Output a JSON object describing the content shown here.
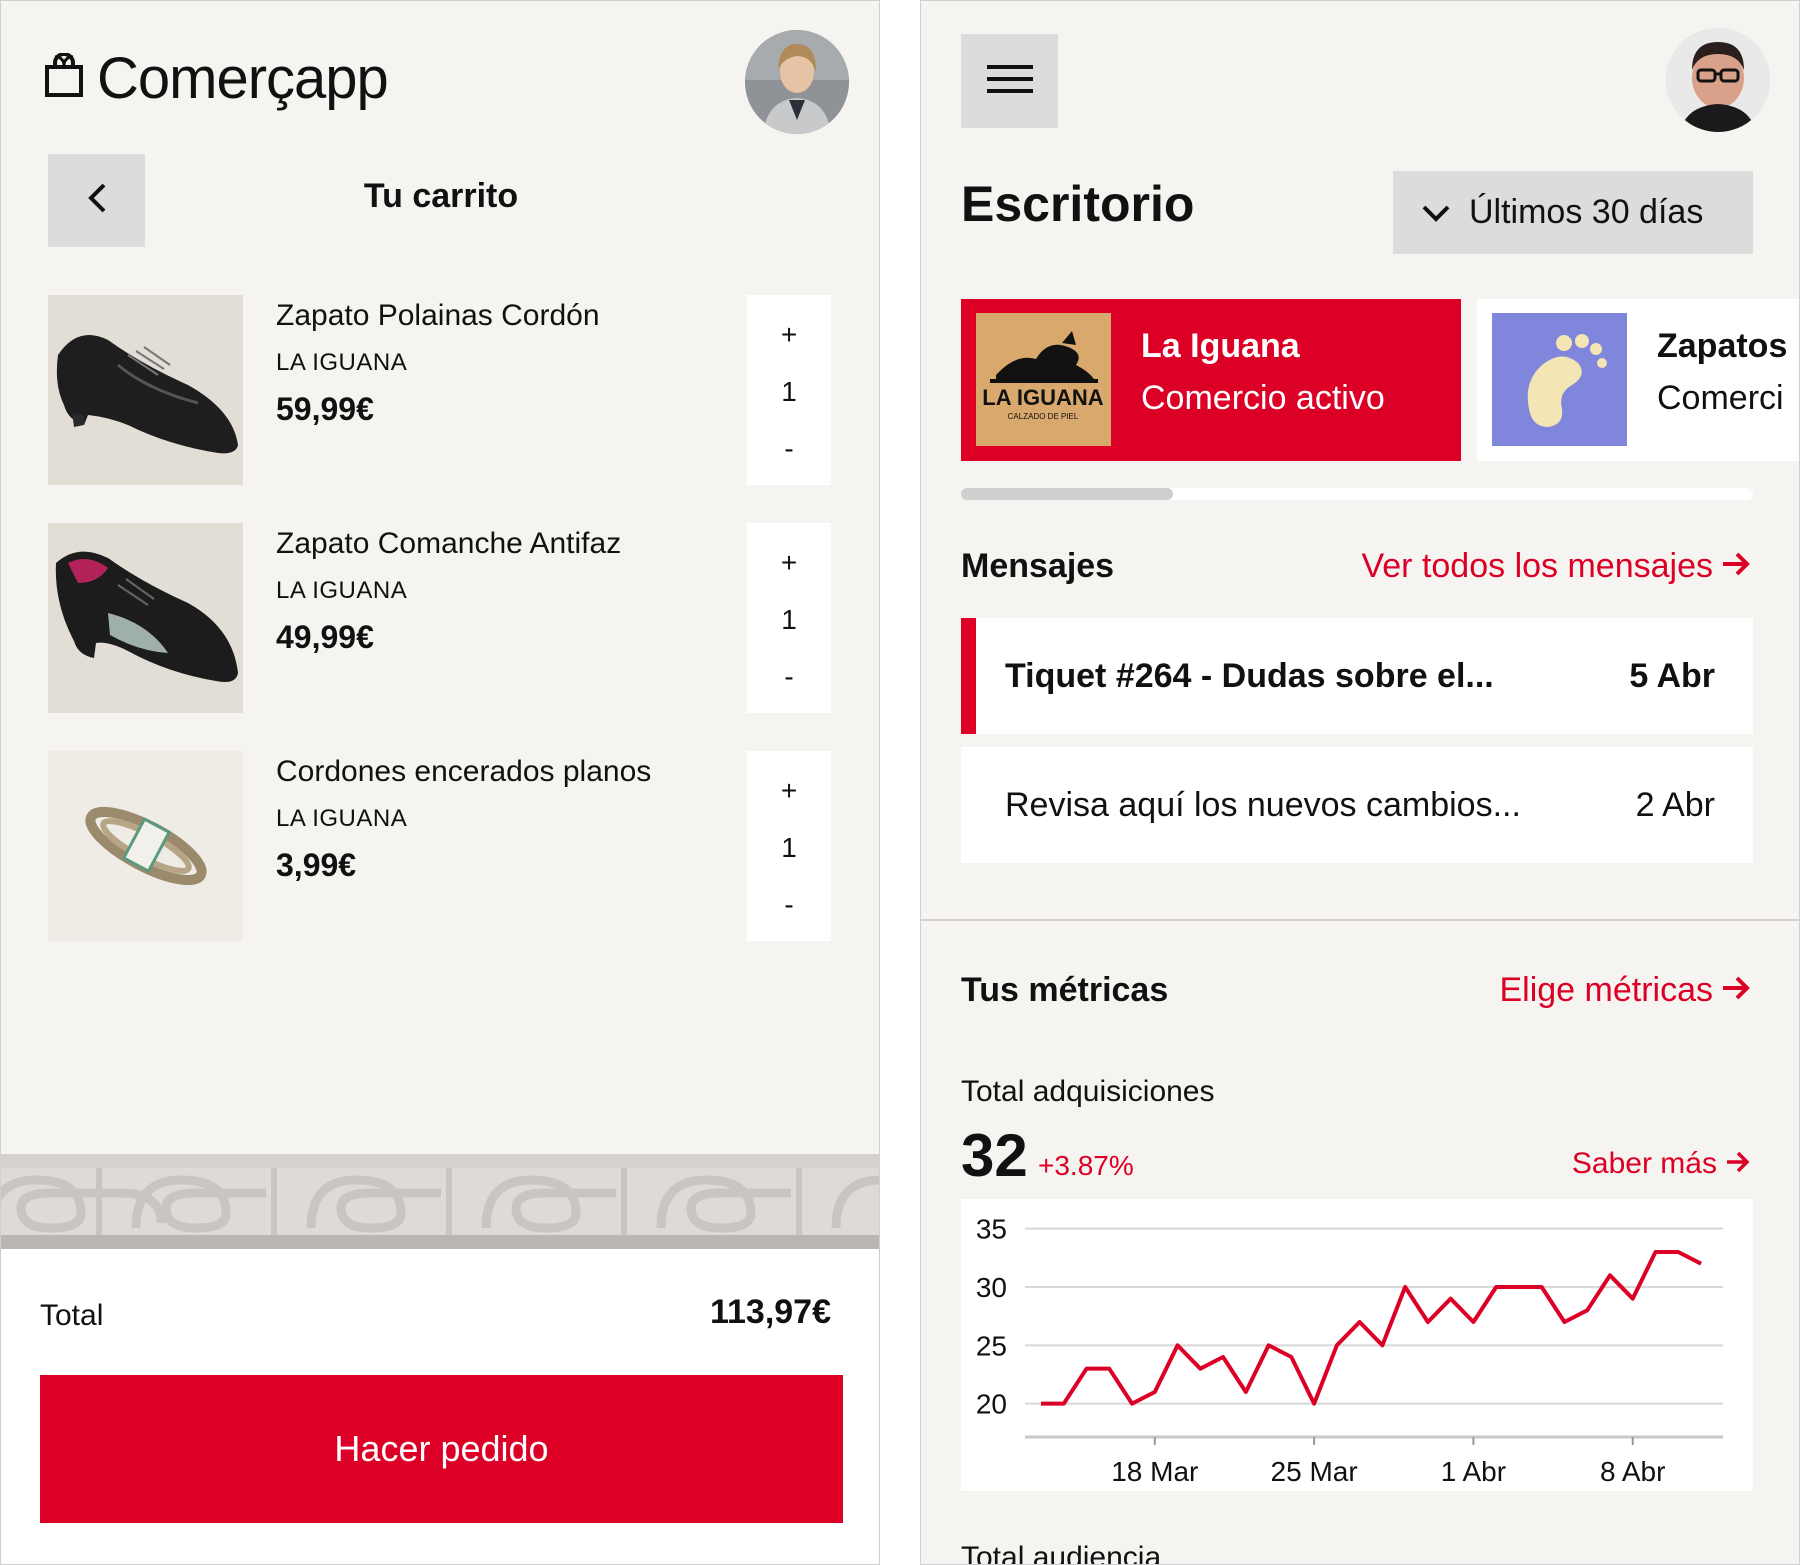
{
  "cart_screen": {
    "brand": "Comerçapp",
    "title": "Tu carrito",
    "items": [
      {
        "name": "Zapato Polainas Cordón",
        "store": "LA IGUANA",
        "price": "59,99€",
        "qty": "1"
      },
      {
        "name": "Zapato Comanche Antifaz",
        "store": "LA IGUANA",
        "price": "49,99€",
        "qty": "1"
      },
      {
        "name": "Cordones encerados planos",
        "store": "LA IGUANA",
        "price": "3,99€",
        "qty": "1"
      }
    ],
    "stepper": {
      "plus": "+",
      "minus": "-"
    },
    "total_label": "Total",
    "total_value": "113,97€",
    "order_button": "Hacer pedido"
  },
  "dashboard_screen": {
    "title": "Escritorio",
    "range": "Últimos 30 días",
    "stores": [
      {
        "name": "La Iguana",
        "status": "Comercio activo",
        "logo_text": "LA IGUANA",
        "logo_sub": "CALZADO DE PIEL"
      },
      {
        "name": "Zapatos",
        "status": "Comerci"
      }
    ],
    "messages_section": {
      "title": "Mensajes",
      "link": "Ver todos los mensajes",
      "items": [
        {
          "subject": "Tiquet #264 - Dudas sobre el...",
          "date": "5 Abr",
          "unread": true
        },
        {
          "subject": "Revisa aquí los nuevos cambios...",
          "date": "2 Abr",
          "unread": false
        }
      ]
    },
    "metrics_section": {
      "title": "Tus métricas",
      "link": "Elige métricas",
      "metric_label": "Total adquisiciones",
      "metric_value": "32",
      "metric_delta": "+3.87%",
      "more_link": "Saber más",
      "next_label": "Total audiencia"
    },
    "colors": {
      "accent": "#dc0026",
      "background": "#f6f4f0",
      "button_gray": "#dcdcdc",
      "store_logo_bg": "#d9a86c",
      "store2_logo_bg": "#7f86dc"
    },
    "icons": [
      "shopping-bag-icon",
      "chevron-left-icon",
      "hamburger-menu-icon",
      "chevron-down-icon",
      "arrow-right-icon"
    ]
  },
  "chart_data": {
    "type": "line",
    "title": "",
    "xlabel": "",
    "ylabel": "",
    "ylim": [
      18,
      36
    ],
    "yticks": [
      20,
      25,
      30,
      35
    ],
    "x": [
      "13 Mar",
      "14 Mar",
      "15 Mar",
      "16 Mar",
      "17 Mar",
      "18 Mar",
      "19 Mar",
      "20 Mar",
      "21 Mar",
      "22 Mar",
      "23 Mar",
      "24 Mar",
      "25 Mar",
      "26 Mar",
      "27 Mar",
      "28 Mar",
      "29 Mar",
      "30 Mar",
      "31 Mar",
      "1 Abr",
      "2 Abr",
      "3 Abr",
      "4 Abr",
      "5 Abr",
      "6 Abr",
      "7 Abr",
      "8 Abr",
      "9 Abr",
      "10 Abr"
    ],
    "xticks": [
      "18 Mar",
      "25 Mar",
      "1 Abr",
      "8 Abr"
    ],
    "series": [
      {
        "values": [
          20,
          20,
          23,
          23,
          20,
          21,
          25,
          23,
          24,
          21,
          25,
          24,
          20,
          25,
          27,
          25,
          30,
          27,
          29,
          27,
          30,
          30,
          30,
          27,
          28,
          31,
          29,
          33,
          33,
          32
        ]
      }
    ],
    "grid": true,
    "legend": "none"
  }
}
